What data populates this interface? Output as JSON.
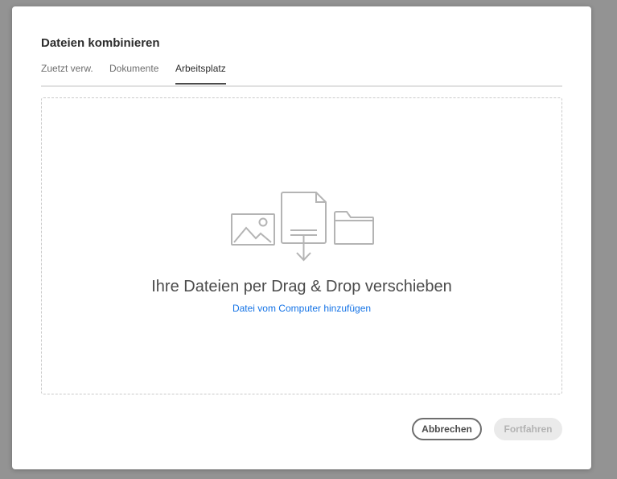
{
  "dialog": {
    "title": "Dateien kombinieren",
    "tabs": [
      {
        "label": "Zuetzt verw.",
        "active": false
      },
      {
        "label": "Dokumente",
        "active": false
      },
      {
        "label": "Arbeitsplatz",
        "active": true
      }
    ],
    "dropzone": {
      "icons": [
        "image-icon",
        "document-download-icon",
        "folder-icon"
      ],
      "main_text": "Ihre Dateien per Drag & Drop verschieben",
      "link_text": "Datei vom Computer hinzufügen"
    },
    "buttons": {
      "cancel_label": "Abbrechen",
      "continue_label": "Fortfahren"
    }
  },
  "colors": {
    "backdrop": "#939393",
    "link": "#1473e6",
    "disabled_button_bg": "#eaeaea",
    "disabled_button_text": "#b3b3b3"
  }
}
